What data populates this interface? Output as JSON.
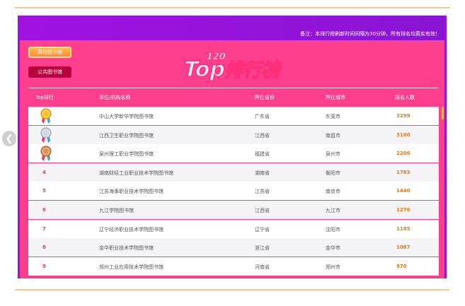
{
  "notice": "备注：本排行榜刷新时间间隔为30分钟，所有排名均真实有效！",
  "tabs": {
    "university": "高校图书馆",
    "public": "公共图书馆"
  },
  "logo": {
    "top": "Top",
    "num": "120",
    "text": "排行榜"
  },
  "columns": [
    "Top排行",
    "单位/机构名称",
    "所在省份",
    "所在城市",
    "报名人数"
  ],
  "rows": [
    {
      "rank": "",
      "name": "中山大学新华学院图书馆",
      "province": "广东省",
      "city": "东莞市",
      "count": "3299",
      "medal": "gold"
    },
    {
      "rank": "",
      "name": "江西卫生职业学院图书馆",
      "province": "江西省",
      "city": "南昌市",
      "count": "3160",
      "medal": "silver"
    },
    {
      "rank": "",
      "name": "泉州理工职业学院图书馆",
      "province": "福建省",
      "city": "泉州市",
      "count": "2206",
      "medal": "bronze"
    },
    {
      "rank": "4",
      "name": "湖南财经工业职业技术学院图书馆",
      "province": "湖南省",
      "city": "衡阳市",
      "count": "1783"
    },
    {
      "rank": "5",
      "name": "江苏海事职业技术学院图书馆",
      "province": "江苏省",
      "city": "南京市",
      "count": "1440"
    },
    {
      "rank": "6",
      "name": "九江学院图书馆",
      "province": "江西省",
      "city": "九江市",
      "count": "1276"
    },
    {
      "rank": "7",
      "name": "辽宁经济职业技术学院图书馆",
      "province": "辽宁省",
      "city": "沈阳市",
      "count": "1185"
    },
    {
      "rank": "8",
      "name": "金华职业技术学院图书馆",
      "province": "浙江省",
      "city": "金华市",
      "count": "1087"
    },
    {
      "rank": "9",
      "name": "郑州工业应用技术学院图书馆",
      "province": "河南省",
      "city": "郑州市",
      "count": "970"
    }
  ],
  "colors": {
    "panel": "#f73f8c",
    "topbar": "#9b12d8",
    "accent_count": "#e07a1a",
    "rank": "#e0357a"
  },
  "icons": {
    "prev": "chevron-left-icon",
    "medal": "medal-icon"
  }
}
